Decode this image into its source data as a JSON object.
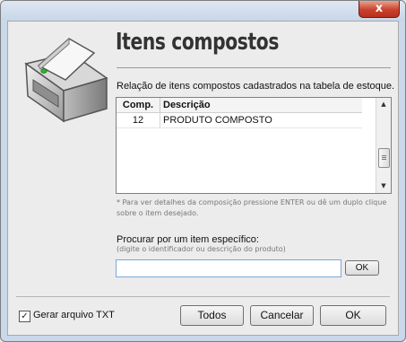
{
  "window": {
    "close_label": "x"
  },
  "header": {
    "title": "Itens compostos"
  },
  "description": "Relação de itens compostos cadastrados na tabela de estoque.",
  "table": {
    "columns": [
      "Comp.",
      "Descrição"
    ],
    "rows": [
      {
        "comp": "12",
        "descricao": "PRODUTO COMPOSTO"
      }
    ]
  },
  "hint": "* Para ver detalhes da composição pressione ENTER ou dê um duplo clique sobre o item desejado.",
  "search": {
    "label": "Procurar por um item específico:",
    "sublabel": "(digite o identificador ou descrição do produto)",
    "value": "",
    "ok_label": "OK"
  },
  "footer": {
    "checkbox_label": "Gerar arquivo TXT",
    "checkbox_checked": true,
    "todos_label": "Todos",
    "cancelar_label": "Cancelar",
    "ok_label": "OK"
  },
  "colors": {
    "title_bar": "#c9d8ea",
    "close_button": "#c9412c",
    "input_border": "#7aa7d9"
  },
  "icons": {
    "logo": "printer-icon",
    "close": "close-icon",
    "check": "checkmark-icon"
  }
}
